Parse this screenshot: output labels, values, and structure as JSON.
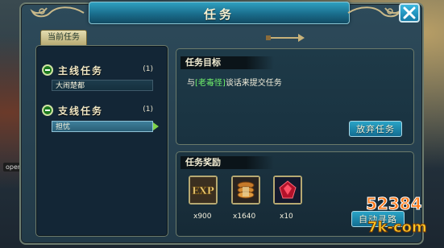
{
  "window": {
    "title": "任务",
    "close_label": "✕"
  },
  "tabs": [
    {
      "label": "当前任务"
    }
  ],
  "quest_list": {
    "categories": [
      {
        "label": "主线任务",
        "count": "(1)",
        "items": [
          "大闹楚都"
        ]
      },
      {
        "label": "支线任务",
        "count": "(1)",
        "items": [
          "担忧"
        ]
      }
    ],
    "selected": "担忧"
  },
  "goal": {
    "header": "任务目标",
    "text_prefix": "与",
    "npc": "[老毒怪]",
    "text_suffix": "谈话来提交任务",
    "abandon_button": "放弃任务"
  },
  "reward": {
    "header": "任务奖励",
    "items": [
      {
        "icon": "exp-icon",
        "label": "EXP",
        "qty": "x900"
      },
      {
        "icon": "coin-scroll-icon",
        "label": "",
        "qty": "x1640"
      },
      {
        "icon": "red-gem-icon",
        "label": "",
        "qty": "x10"
      }
    ],
    "auto_button": "自动寻路"
  },
  "side": {
    "open_label": "open"
  },
  "watermark": {
    "number": "52384",
    "code": "7k-com"
  },
  "colors": {
    "npc": "#6ff06b",
    "accent": "#1e8cb4"
  }
}
